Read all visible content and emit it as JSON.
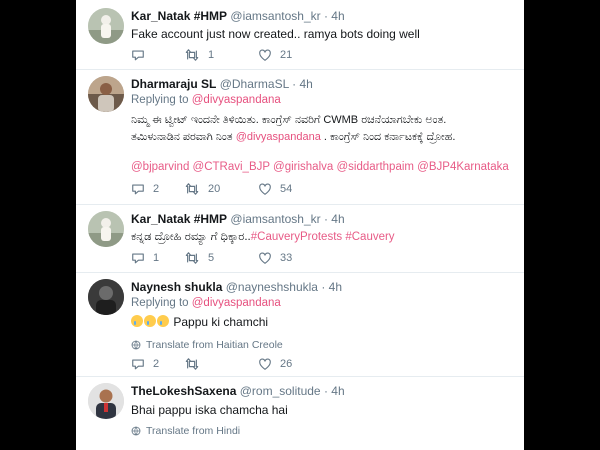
{
  "tweets": [
    {
      "name": "Kar_Natak #HMP",
      "handle": "@iamsantosh_kr",
      "time": "· 4h",
      "text": "Fake account just now created.. ramya bots doing well",
      "replies": "",
      "retweets": "1",
      "likes": "21"
    },
    {
      "name": "Dharmaraju SL",
      "handle": "@DharmaSL",
      "time": "· 4h",
      "replying_label": "Replying to",
      "replying_to": "@divyaspandana",
      "text_line1": "ನಿಮ್ಮ ಈ ಟ್ವೀಟ್ ಇಂದನೇ ತಿಳಿಯಿತು. ಕಾಂಗ್ರೆಸ್ ನವರಿಗೆ CWMB ರಚನೆಯಾಗಬೇಕು ಅಂತ.",
      "text_line2a": "ತಮಿಳುನಾಡಿನ ಪರವಾಗಿ ನಿಂತ",
      "text_mention": "@divyaspandana",
      "text_line2b": ". ಕಾಂಗ್ರೆಸ್ ನಿಂದ ಕರ್ನಾಟಕಕ್ಕೆ ದ್ರೋಹ.",
      "tags": "@bjparvind @CTRavi_BJP @girishalva @siddarthpaim @BJP4Karnataka",
      "replies": "2",
      "retweets": "20",
      "likes": "54"
    },
    {
      "name": "Kar_Natak #HMP",
      "handle": "@iamsantosh_kr",
      "time": "· 4h",
      "text": "ಕನ್ನಡ ದ್ರೋಹಿ ರಮ್ಯಾ ಗೆ ಧಿಕ್ಕಾರ..",
      "tags": "#CauveryProtests #Cauvery",
      "replies": "1",
      "retweets": "5",
      "likes": "33"
    },
    {
      "name": "Naynesh shukla",
      "handle": "@nayneshshukla",
      "time": "· 4h",
      "replying_label": "Replying to",
      "replying_to": "@divyaspandana",
      "text": "Pappu ki chamchi",
      "translate": "Translate from Haitian Creole",
      "replies": "2",
      "retweets": "",
      "likes": "26"
    },
    {
      "name": "TheLokeshSaxena",
      "handle": "@rom_solitude",
      "time": "· 4h",
      "text": "Bhai pappu iska chamcha hai",
      "translate": "Translate from Hindi"
    }
  ],
  "icons": {
    "reply": "reply-icon",
    "retweet": "retweet-icon",
    "like": "heart-icon",
    "translate": "globe-icon"
  },
  "colors": {
    "name": "#14171a",
    "meta": "#657786",
    "link": "#e0245e",
    "divider": "#e6ecf0"
  }
}
